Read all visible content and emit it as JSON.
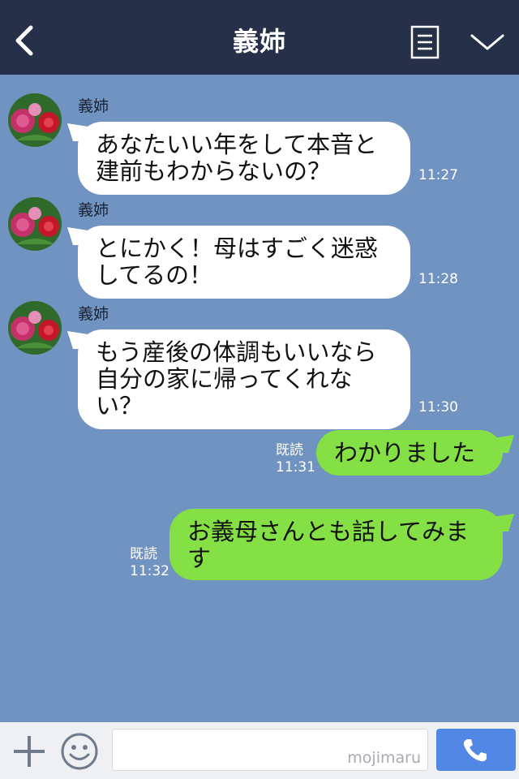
{
  "header": {
    "title": "義姉"
  },
  "messages": [
    {
      "sender": "義姉",
      "text": "あなたいい年をして本音と建前もわからないの？",
      "time": "11:27"
    },
    {
      "sender": "義姉",
      "text": "とにかく！母はすごく迷惑してるの！",
      "time": "11:28"
    },
    {
      "sender": "義姉",
      "text": "もう産後の体調もいいなら自分の家に帰ってくれない？",
      "time": "11:30"
    },
    {
      "text": "わかりました",
      "read": "既読",
      "time": "11:31"
    },
    {
      "text": "お義母さんとも話してみます",
      "read": "既読",
      "time": "11:32"
    }
  ],
  "footer": {
    "watermark": "mojimaru"
  },
  "colors": {
    "header": "#263149",
    "background": "#7093c1",
    "outgoing": "#84e045",
    "incoming": "#ffffff",
    "call": "#5387e6"
  },
  "icons": [
    "back-icon",
    "note-icon",
    "chevron-down-icon",
    "plus-icon",
    "smile-icon",
    "phone-icon"
  ]
}
